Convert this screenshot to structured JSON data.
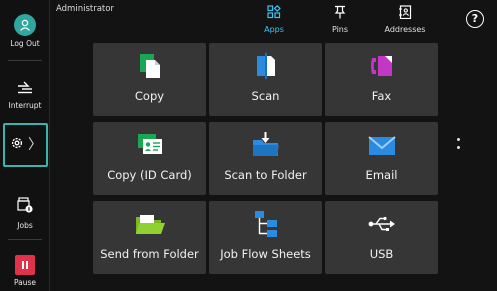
{
  "header": {
    "user": "Administrator",
    "tabs": [
      {
        "label": "Apps",
        "icon": "apps-icon",
        "active": true
      },
      {
        "label": "Pins",
        "icon": "pin-icon",
        "active": false
      },
      {
        "label": "Addresses",
        "icon": "address-book-icon",
        "active": false
      }
    ],
    "help_label": "?"
  },
  "sidebar": {
    "items": [
      {
        "label": "Log Out",
        "icon": "logout-icon"
      },
      {
        "label": "Interrupt",
        "icon": "interrupt-icon"
      },
      {
        "label": "",
        "icon": "gear-icon",
        "selected": true
      },
      {
        "label": "Jobs",
        "icon": "jobs-icon"
      },
      {
        "label": "Pause",
        "icon": "pause-icon"
      }
    ]
  },
  "apps": [
    {
      "label": "Copy",
      "icon": "copy-icon"
    },
    {
      "label": "Scan",
      "icon": "scan-icon"
    },
    {
      "label": "Fax",
      "icon": "fax-icon"
    },
    {
      "label": "Copy (ID Card)",
      "icon": "id-card-icon"
    },
    {
      "label": "Scan to Folder",
      "icon": "scan-to-folder-icon"
    },
    {
      "label": "Email",
      "icon": "email-icon"
    },
    {
      "label": "Send from Folder",
      "icon": "send-from-folder-icon"
    },
    {
      "label": "Job Flow Sheets",
      "icon": "job-flow-icon"
    },
    {
      "label": "USB",
      "icon": "usb-icon"
    }
  ],
  "colors": {
    "accent": "#3ec4f0",
    "teal": "#2fa7a0",
    "pause": "#e0334b",
    "tile": "#363636",
    "background": "#131313"
  }
}
